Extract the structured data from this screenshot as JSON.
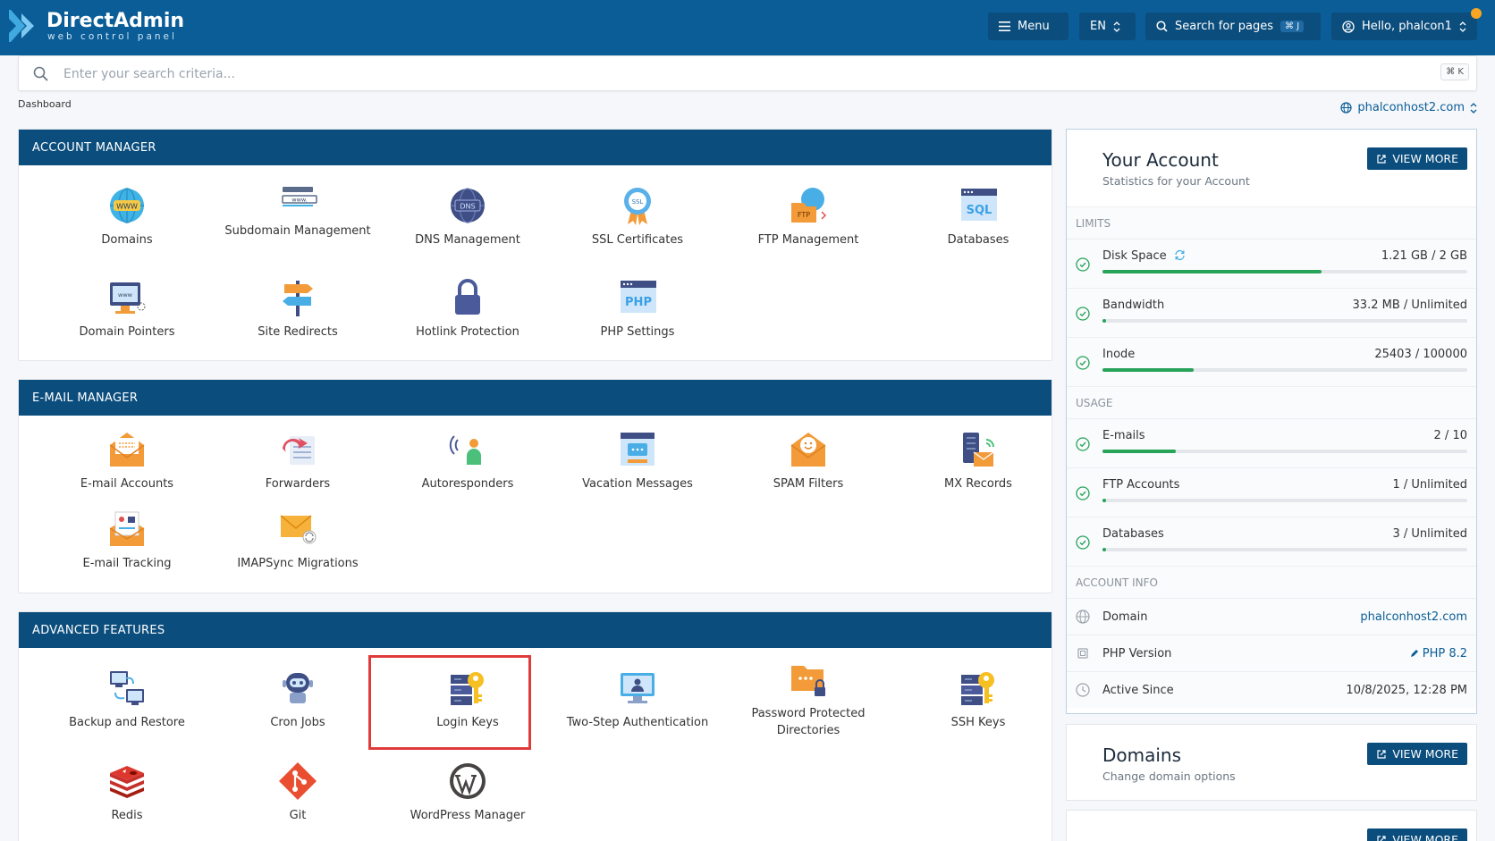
{
  "brand": {
    "title": "DirectAdmin",
    "subtitle": "web control panel"
  },
  "topbar": {
    "menu_label": "Menu",
    "lang_label": "EN",
    "search_pages_label": "Search for pages",
    "search_pages_kbd": "⌘ J",
    "user_label": "Hello, phalcon1"
  },
  "search": {
    "placeholder": "Enter your search criteria...",
    "kbd": "⌘ K"
  },
  "breadcrumb": "Dashboard",
  "domain_selector": "phalconhost2.com",
  "sections": [
    {
      "title": "ACCOUNT MANAGER",
      "items": [
        {
          "label": "Domains",
          "icon": "globe-www-icon"
        },
        {
          "label": "Subdomain Management",
          "icon": "subdomain-icon"
        },
        {
          "label": "DNS Management",
          "icon": "dns-globe-icon"
        },
        {
          "label": "SSL Certificates",
          "icon": "ssl-badge-icon"
        },
        {
          "label": "FTP Management",
          "icon": "ftp-folder-icon"
        },
        {
          "label": "Databases",
          "icon": "sql-database-icon"
        },
        {
          "label": "Domain Pointers",
          "icon": "domain-pointer-icon"
        },
        {
          "label": "Site Redirects",
          "icon": "signpost-icon"
        },
        {
          "label": "Hotlink Protection",
          "icon": "padlock-icon"
        },
        {
          "label": "PHP Settings",
          "icon": "php-icon"
        }
      ]
    },
    {
      "title": "E-MAIL MANAGER",
      "items": [
        {
          "label": "E-mail Accounts",
          "icon": "email-envelope-icon"
        },
        {
          "label": "Forwarders",
          "icon": "forward-arrow-icon"
        },
        {
          "label": "Autoresponders",
          "icon": "autoresponder-icon"
        },
        {
          "label": "Vacation Messages",
          "icon": "vacation-message-icon"
        },
        {
          "label": "SPAM Filters",
          "icon": "spam-filter-icon"
        },
        {
          "label": "MX Records",
          "icon": "mx-records-icon"
        },
        {
          "label": "E-mail Tracking",
          "icon": "email-tracking-icon"
        },
        {
          "label": "IMAPSync Migrations",
          "icon": "imapsync-icon"
        }
      ]
    },
    {
      "title": "ADVANCED FEATURES",
      "items": [
        {
          "label": "Backup and Restore",
          "icon": "backup-computers-icon"
        },
        {
          "label": "Cron Jobs",
          "icon": "robot-icon"
        },
        {
          "label": "Login Keys",
          "icon": "server-key-icon"
        },
        {
          "label": "Two-Step Authentication",
          "icon": "two-step-auth-icon"
        },
        {
          "label": "Password Protected Directories",
          "icon": "locked-folder-icon"
        },
        {
          "label": "SSH Keys",
          "icon": "ssh-key-icon"
        },
        {
          "label": "Redis",
          "icon": "redis-icon"
        },
        {
          "label": "Git",
          "icon": "git-icon"
        },
        {
          "label": "WordPress Manager",
          "icon": "wordpress-icon"
        }
      ]
    }
  ],
  "your_account": {
    "title": "Your Account",
    "subtitle": "Statistics for your Account",
    "view_more": "VIEW MORE",
    "limits_label": "LIMITS",
    "limits": [
      {
        "name": "Disk Space",
        "value": "1.21 GB / 2 GB",
        "fraction": 0.6
      },
      {
        "name": "Bandwidth",
        "value": "33.2 MB / Unlimited",
        "fraction": 0.01
      },
      {
        "name": "Inode",
        "value": "25403 / 100000",
        "fraction": 0.25
      }
    ],
    "usage_label": "USAGE",
    "usage": [
      {
        "name": "E-mails",
        "value": "2 / 10",
        "fraction": 0.2
      },
      {
        "name": "FTP Accounts",
        "value": "1 / Unlimited",
        "fraction": 0.01
      },
      {
        "name": "Databases",
        "value": "3 / Unlimited",
        "fraction": 0.01
      }
    ],
    "account_info_label": "ACCOUNT INFO",
    "account_info": [
      {
        "name": "Domain",
        "value": "phalconhost2.com"
      },
      {
        "name": "PHP Version",
        "value": "PHP 8.2"
      },
      {
        "name": "Active Since",
        "value": "10/8/2025, 12:28 PM"
      }
    ]
  },
  "domains_card": {
    "title": "Domains",
    "subtitle": "Change domain options",
    "view_more": "VIEW MORE"
  },
  "partial_card": {
    "view_more": "VIEW MORE"
  },
  "colors": {
    "brand_blue": "#0a5d97",
    "header_blue": "#0b4d7d",
    "progress_green": "#27a35a",
    "highlight_red": "#e03b3b"
  }
}
